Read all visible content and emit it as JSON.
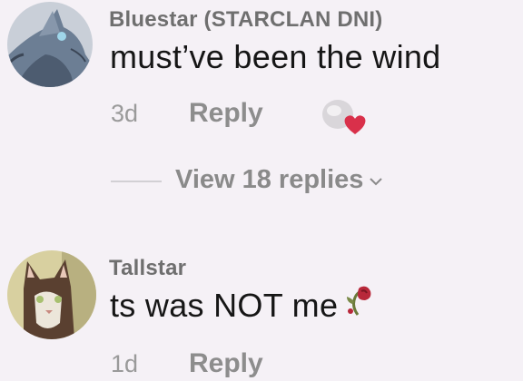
{
  "comments": [
    {
      "username": "Bluestar (STARCLAN DNI)",
      "text": "must’ve been the wind",
      "time": "3d",
      "reply_label": "Reply",
      "avatar_icon": "blue-cat-avatar",
      "like_icon": "heart-like-icon"
    },
    {
      "username": "Tallstar",
      "text": "ts was NOT me",
      "emoji_icon": "wilted-rose-icon",
      "time": "1d",
      "reply_label": "Reply",
      "avatar_icon": "brown-cat-avatar"
    }
  ],
  "replies": {
    "label": "View 18 replies"
  },
  "colors": {
    "background": "#f5f1f6",
    "username": "#6f6f6f",
    "meta": "#9a9a9a",
    "heart": "#d9304a"
  }
}
